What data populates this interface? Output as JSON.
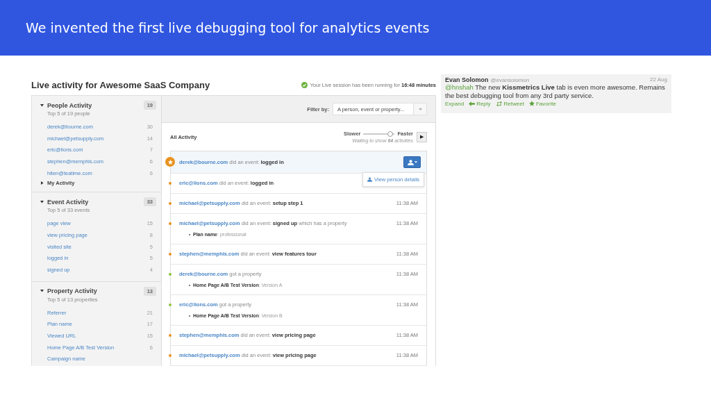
{
  "banner": {
    "title": "We invented the first live debugging tool for analytics events"
  },
  "app": {
    "title": "Live activity for Awesome SaaS Company",
    "session_status": "Your Live session has been running for **16:48 minutes**",
    "sidebar": [
      {
        "title": "People Activity",
        "count": "19",
        "subtitle": "Top 5 of 19 people",
        "expanded": true,
        "items": [
          {
            "label": "derek@bourne.com",
            "count": "30"
          },
          {
            "label": "michael@petsupply.com",
            "count": "14"
          },
          {
            "label": "eric@lions.com",
            "count": "7"
          },
          {
            "label": "stephen@memphis.com",
            "count": "6"
          },
          {
            "label": "hiten@teatime.com",
            "count": "6"
          }
        ],
        "extra": {
          "label": "My Activity",
          "expanded": false
        }
      },
      {
        "title": "Event Activity",
        "count": "33",
        "subtitle": "Top 5 of 33 events",
        "expanded": true,
        "items": [
          {
            "label": "page view",
            "count": "15"
          },
          {
            "label": "view pricing page",
            "count": "8"
          },
          {
            "label": "visited site",
            "count": "5"
          },
          {
            "label": "logged in",
            "count": "5"
          },
          {
            "label": "signed up",
            "count": "4"
          }
        ]
      },
      {
        "title": "Property Activity",
        "count": "13",
        "subtitle": "Top 5 of 13 properties",
        "expanded": true,
        "items": [
          {
            "label": "Referrer",
            "count": "21"
          },
          {
            "label": "Plan name",
            "count": "17"
          },
          {
            "label": "Viewed URL",
            "count": "15"
          },
          {
            "label": "Home Page A/B Test Version",
            "count": "6"
          },
          {
            "label": "Campaign name"
          }
        ]
      }
    ],
    "filter": {
      "label": "Filter by:",
      "placeholder": "A person, event or property..."
    },
    "activity": {
      "title": "All Activity",
      "slow_label": "Slower",
      "fast_label": "Faster",
      "level": 0.85,
      "waiting": "Waiting to show **64** activities",
      "play": "▶"
    },
    "events": [
      {
        "person": "derek@bourne.com",
        "text": "did an event: **logged in**",
        "color": "#e8931e",
        "selected": true,
        "menu": "View person details"
      },
      {
        "person": "eric@lions.com",
        "text": "did an event: **logged in**",
        "color": "#e8931e",
        "selected": false
      },
      {
        "person": "michael@petsupply.com",
        "text": "did an event: **setup step 1**",
        "color": "#e8931e",
        "selected": false,
        "time": "11:38 AM"
      },
      {
        "person": "michael@petsupply.com",
        "text": "did an event: **signed up** which has a property",
        "color": "#e8931e",
        "selected": false,
        "time": "11:38 AM",
        "property": {
          "name": "Plan name",
          "value": ": professional"
        }
      },
      {
        "person": "stephen@memphis.com",
        "text": "did an event: **view features tour**",
        "color": "#e8931e",
        "selected": false,
        "time": "11:38 AM"
      },
      {
        "person": "derek@bourne.com",
        "text": "got a property",
        "color": "#8cc63f",
        "selected": false,
        "time": "11:38 AM",
        "property": {
          "name": "Home Page A/B Test Version",
          "value": ": Version A"
        }
      },
      {
        "person": "eric@lions.com",
        "text": "got a property",
        "color": "#8cc63f",
        "selected": false,
        "time": "11:38 AM",
        "property": {
          "name": "Home Page A/B Test Version",
          "value": ": Version B"
        }
      },
      {
        "person": "stephen@memphis.com",
        "text": "did an event: **view pricing page**",
        "color": "#e8931e",
        "selected": false,
        "time": "11:38 AM"
      },
      {
        "person": "michael@petsupply.com",
        "text": "did an event: **view pricing page**",
        "color": "#e8931e",
        "selected": false,
        "time": "11:38 AM"
      }
    ]
  },
  "tweet": {
    "name": "Evan Solomon",
    "handle": "@evansolomon",
    "date": "22 Aug",
    "mention": "@hnshah",
    "text": "The new **Kissmetrics Live** tab is even more awesome. Remains the best debugging tool from any 3rd party service.",
    "actions": [
      {
        "label": "Expand"
      },
      {
        "label": "Reply",
        "kind": "reply"
      },
      {
        "label": "Retweet",
        "kind": "retweet"
      },
      {
        "label": "Favorite",
        "kind": "favorite"
      }
    ]
  }
}
